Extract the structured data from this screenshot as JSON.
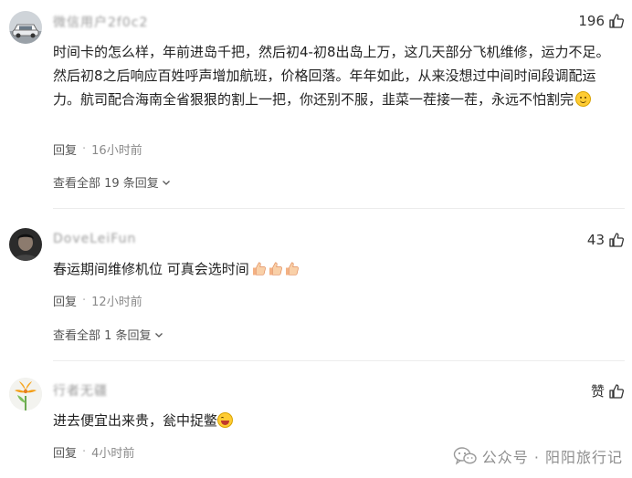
{
  "comments": [
    {
      "username": "微信用户2f0c2",
      "likes": "196",
      "text": "时间卡的怎么样，年前进岛千把，然后初4-初8出岛上万，这几天部分飞机维修，运力不足。然后初8之后响应百姓呼声增加航班，价格回落。年年如此，从来没想过中间时间段调配运力。航司配合海南全省狠狠的割上一把，你还别不服，韭菜一茬接一茬，永远不怕割完",
      "emoji": "smile-emoji",
      "reply_label": "回复",
      "time": "16小时前",
      "view_all": "查看全部 19 条回复"
    },
    {
      "username": "DoveLeiFun",
      "likes": "43",
      "text": "春运期间维修机位 可真会选时间",
      "emoji": "thumbs-up-emoji",
      "reply_label": "回复",
      "time": "12小时前",
      "view_all": "查看全部 1 条回复"
    },
    {
      "username": "行者无疆",
      "likes": "赞",
      "text": "进去便宜出来贵，瓮中捉鳖",
      "emoji": "laughing-emoji",
      "reply_label": "回复",
      "time": "4小时前"
    }
  ],
  "watermark": {
    "text": "公众号 · 阳阳旅行记",
    "icon": "wechat-icon"
  },
  "colors": {
    "text": "#222222",
    "meta": "#8a8a8a",
    "divider": "#ececec",
    "watermark": "#8e8e8e"
  }
}
